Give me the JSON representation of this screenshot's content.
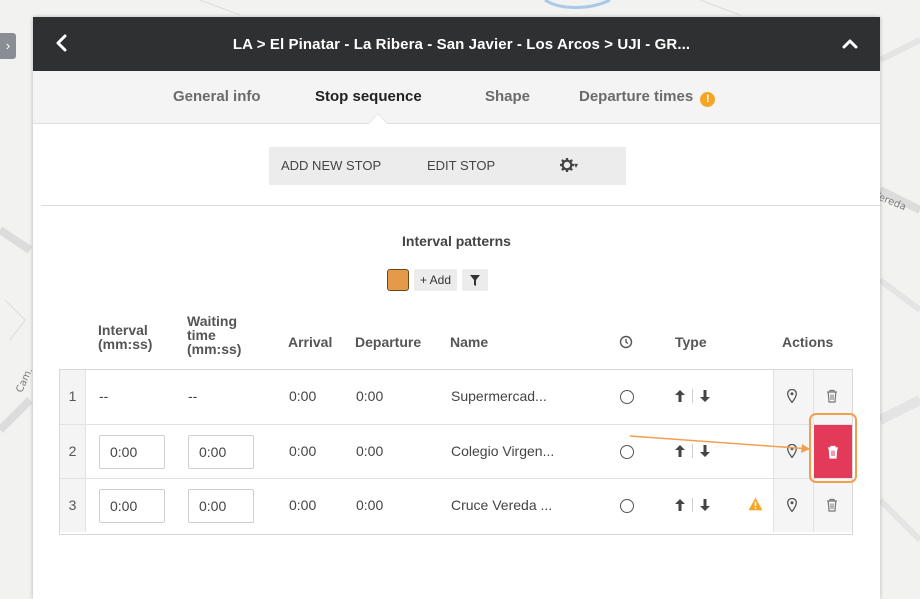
{
  "map": {
    "labels": {
      "vereda": "Vereda",
      "cam": "Cam. ."
    },
    "expand_icon": "chevron-right-icon"
  },
  "header": {
    "title": "LA > El Pinatar - La Ribera - San Javier - Los Arcos > UJI - GR...",
    "back_icon": "chevron-left-icon",
    "collapse_icon": "chevron-up-icon"
  },
  "tabs": [
    {
      "label": "General info",
      "active": false
    },
    {
      "label": "Stop sequence",
      "active": true
    },
    {
      "label": "Shape",
      "active": false
    },
    {
      "label": "Departure times",
      "active": false,
      "badge": "!"
    }
  ],
  "toolbar": {
    "add_stop": "ADD NEW STOP",
    "edit_stop": "EDIT STOP",
    "settings_icon": "gear-icon",
    "caret": "▾"
  },
  "interval_patterns": {
    "title": "Interval patterns",
    "swatch_color": "#e59a4a",
    "add_label": "+ Add",
    "filter_icon": "filter-icon"
  },
  "table": {
    "headers": {
      "interval_1": "Interval",
      "interval_2": "(mm:ss)",
      "waiting_1": "Waiting",
      "waiting_2": "time",
      "waiting_3": "(mm:ss)",
      "arrival": "Arrival",
      "departure": "Departure",
      "name": "Name",
      "timepoint_icon": "clock-icon",
      "type": "Type",
      "actions": "Actions"
    },
    "rows": [
      {
        "num": "1",
        "interval": "--",
        "waiting": "--",
        "arrival": "0:00",
        "departure": "0:00",
        "name": "Supermercad...",
        "warning": false
      },
      {
        "num": "2",
        "interval": "0:00",
        "waiting": "0:00",
        "arrival": "0:00",
        "departure": "0:00",
        "name": "Colegio Virgen...",
        "warning": false
      },
      {
        "num": "3",
        "interval": "0:00",
        "waiting": "0:00",
        "arrival": "0:00",
        "departure": "0:00",
        "name": "Cruce Vereda ...",
        "warning": true
      }
    ]
  },
  "colors": {
    "header_bg": "#2e3032",
    "delete_active": "#e23a58",
    "highlight": "#f0a050",
    "warning": "#f5a524"
  }
}
